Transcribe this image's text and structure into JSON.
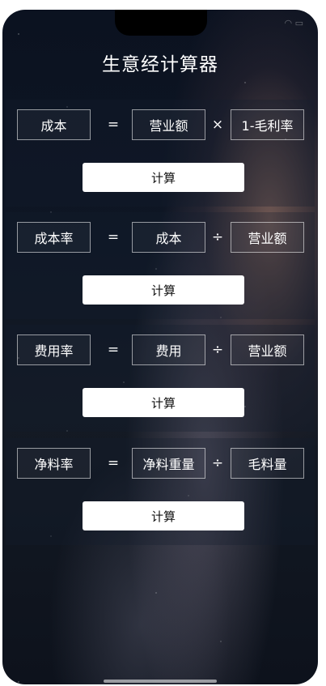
{
  "app": {
    "title": "生意经计算器"
  },
  "formulas": [
    {
      "result": "成本",
      "eq": "=",
      "left": "营业额",
      "op": "×",
      "right": "1-毛利率",
      "button": "计算"
    },
    {
      "result": "成本率",
      "eq": "=",
      "left": "成本",
      "op": "÷",
      "right": "营业额",
      "button": "计算"
    },
    {
      "result": "费用率",
      "eq": "=",
      "left": "费用",
      "op": "÷",
      "right": "营业额",
      "button": "计算"
    },
    {
      "result": "净料率",
      "eq": "=",
      "left": "净料重量",
      "op": "÷",
      "right": "毛料量",
      "button": "计算"
    }
  ],
  "colors": {
    "button_bg": "#ffffff",
    "text": "#ffffff",
    "border": "rgba(255,255,255,0.55)"
  }
}
